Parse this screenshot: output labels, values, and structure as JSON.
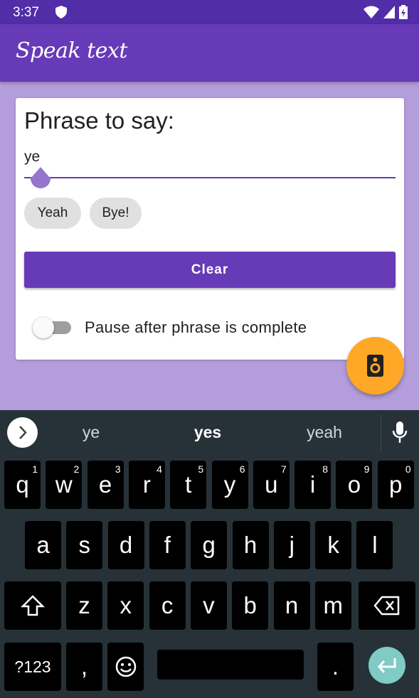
{
  "status_bar": {
    "time": "3:37"
  },
  "app_bar": {
    "title": "Speak text"
  },
  "card": {
    "title": "Phrase to say:",
    "input_value": "ye",
    "chips": [
      "Yeah",
      "Bye!"
    ],
    "clear_label": "Clear",
    "toggle_label": "Pause after phrase is complete",
    "toggle_on": false
  },
  "fab": {
    "icon": "speaker-icon"
  },
  "keyboard": {
    "suggestions": [
      "ye",
      "yes",
      "yeah"
    ],
    "row1": [
      {
        "k": "q",
        "n": "1"
      },
      {
        "k": "w",
        "n": "2"
      },
      {
        "k": "e",
        "n": "3"
      },
      {
        "k": "r",
        "n": "4"
      },
      {
        "k": "t",
        "n": "5"
      },
      {
        "k": "y",
        "n": "6"
      },
      {
        "k": "u",
        "n": "7"
      },
      {
        "k": "i",
        "n": "8"
      },
      {
        "k": "o",
        "n": "9"
      },
      {
        "k": "p",
        "n": "0"
      }
    ],
    "row2": [
      "a",
      "s",
      "d",
      "f",
      "g",
      "h",
      "j",
      "k",
      "l"
    ],
    "row3": [
      "z",
      "x",
      "c",
      "v",
      "b",
      "n",
      "m"
    ],
    "symbols_label": "?123",
    "comma": ",",
    "period": "."
  },
  "colors": {
    "primary": "#673ab7",
    "primary_dark": "#512da8",
    "background": "#b39ddb",
    "accent": "#ffa726",
    "keyboard_bg": "#263238"
  }
}
